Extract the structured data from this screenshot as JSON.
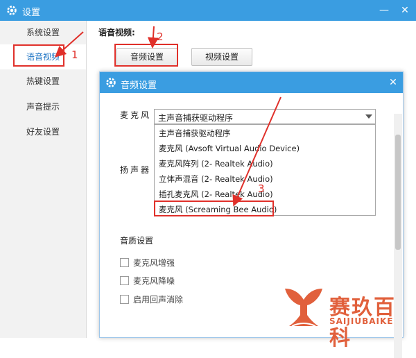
{
  "window": {
    "title": "设置"
  },
  "sidebar": {
    "items": [
      {
        "label": "系统设置"
      },
      {
        "label": "语音视频"
      },
      {
        "label": "热键设置"
      },
      {
        "label": "声音提示"
      },
      {
        "label": "好友设置"
      }
    ]
  },
  "main": {
    "section_label": "语音视频:",
    "audio_button": "音频设置",
    "video_button": "视频设置"
  },
  "dialog": {
    "title": "音频设置",
    "mic_label": "麦克风",
    "speaker_label": "扬声器",
    "mic_selected": "主声音捕获驱动程序",
    "mic_options": [
      "主声音捕获驱动程序",
      "麦克风 (Avsoft Virtual Audio Device)",
      "麦克风阵列 (2- Realtek Audio)",
      "立体声混音 (2- Realtek Audio)",
      "插孔麦克风 (2- Realtek Audio)",
      "麦克风 (Screaming Bee Audio)"
    ],
    "quality_label": "音质设置",
    "checkboxes": [
      {
        "label": "麦克风增强",
        "checked": false
      },
      {
        "label": "麦克风降噪",
        "checked": false
      },
      {
        "label": "启用回声消除",
        "checked": false
      }
    ]
  },
  "annotations": {
    "step1": "1",
    "step2": "2",
    "step3": "3"
  },
  "watermark": {
    "cn": "赛玖百科",
    "en": "SAIJIUBAIKE"
  },
  "colors": {
    "title_bar": "#3a9de1",
    "annotation": "#e0302a",
    "watermark": "#e1603c",
    "active_tab_text": "#1d74c4"
  }
}
